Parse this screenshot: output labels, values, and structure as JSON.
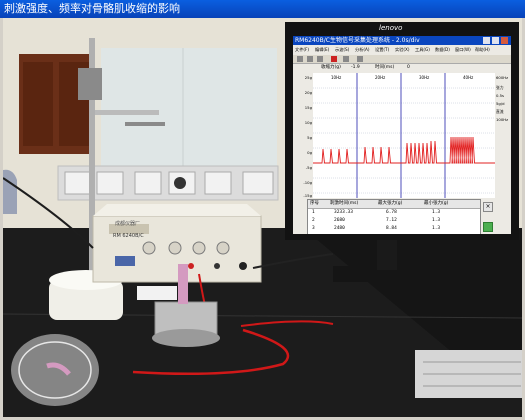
{
  "window": {
    "title": "刺激强度、频率对骨骼肌收缩的影响"
  },
  "monitor": {
    "brand": "lenovo"
  },
  "app": {
    "title": "RM6240B/C生物信号采集处理系统 - 2.0s/div",
    "menu": [
      "文件(F)",
      "编辑(E)",
      "示波(S)",
      "分析(A)",
      "设置(T)",
      "实验(X)",
      "工具(G)",
      "数据(D)",
      "窗口(W)",
      "帮助(H)"
    ],
    "info": {
      "force_label": "收缩力(g)",
      "force_value": "-1.9",
      "time_label": "时间(ms)",
      "time_value": "0"
    },
    "y_ticks": [
      "25g",
      "20g",
      "15g",
      "10g",
      "5g",
      "0g",
      "-5g",
      "-10g",
      "-15g"
    ],
    "seg_labels": [
      "10Hz",
      "20Hz",
      "30Hz",
      "40Hz"
    ],
    "side": [
      "600Hz",
      "张力",
      "0.5s",
      "5g/d",
      "直流",
      "100Hz"
    ],
    "table": {
      "headers": [
        "序号",
        "刺激时间(ms)",
        "最大张力(g)",
        "最小张力(g)"
      ],
      "rows": [
        [
          "1",
          "3233.33",
          "6.78",
          "1.3"
        ],
        [
          "2",
          "2680",
          "7.12",
          "1.3"
        ],
        [
          "3",
          "2480",
          "8.84",
          "1.3"
        ]
      ]
    }
  },
  "stimulator": {
    "model": "RM 6240B/C",
    "brand": "成都仪器厂"
  }
}
